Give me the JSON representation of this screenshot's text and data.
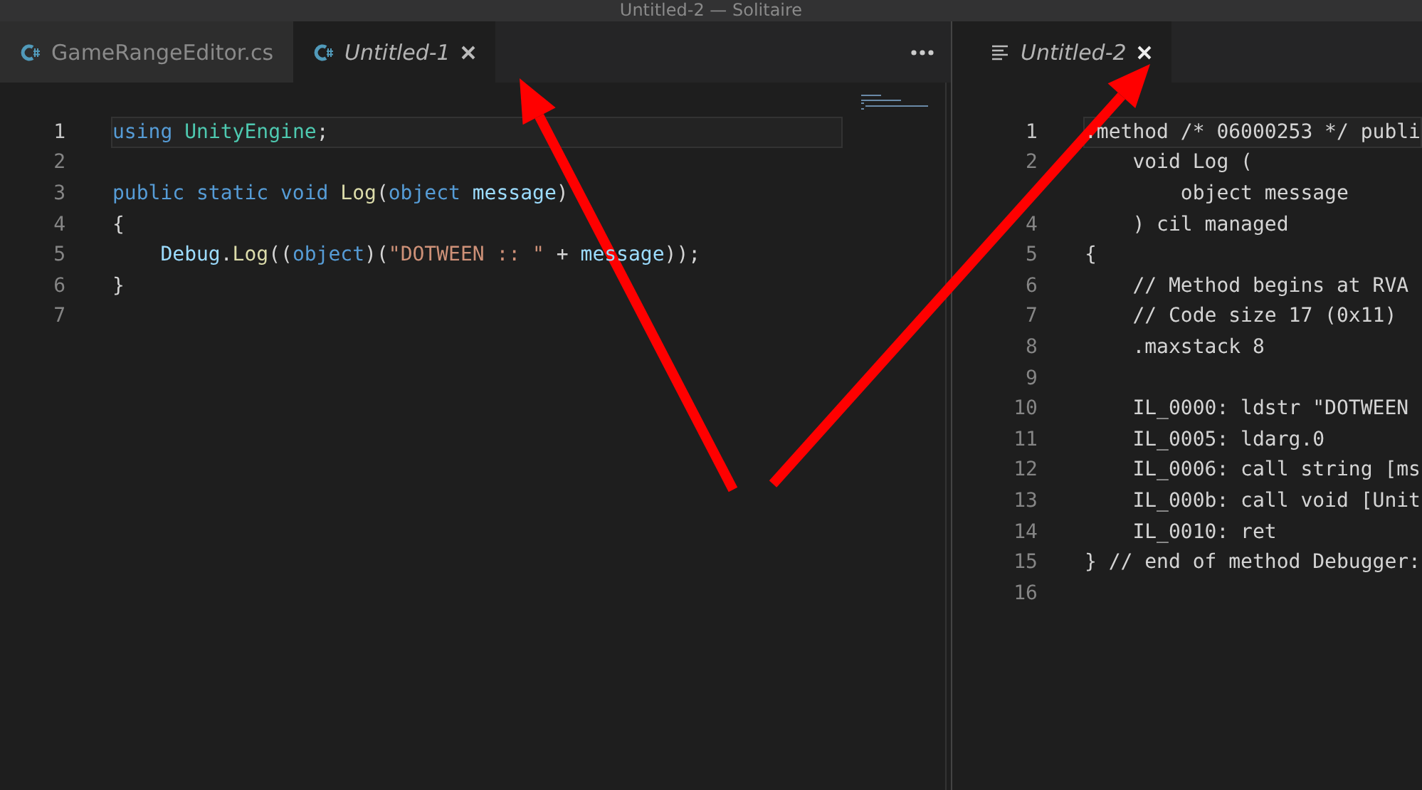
{
  "window": {
    "title": "Untitled-2 — Solitaire"
  },
  "left_group": {
    "tabs": [
      {
        "label": "GameRangeEditor.cs",
        "kind": "csharp",
        "selected": false,
        "preview": false
      },
      {
        "label": "Untitled-1",
        "kind": "csharp",
        "selected": true,
        "preview": true
      }
    ],
    "editor": {
      "lines": [
        {
          "number": "1",
          "current": true,
          "tokens": [
            {
              "kind": "keyword",
              "text": "using"
            },
            {
              "kind": "type",
              "text": " UnityEngine"
            },
            {
              "kind": "plain",
              "text": ";"
            }
          ]
        },
        {
          "number": "2",
          "current": false
        },
        {
          "number": "3",
          "current": false,
          "tokens": [
            {
              "kind": "keyword",
              "text": "public static void"
            },
            {
              "kind": "function",
              "text": " Log"
            },
            {
              "kind": "plain",
              "text": "("
            },
            {
              "kind": "keyword",
              "text": "object"
            },
            {
              "kind": "variable",
              "text": " message"
            },
            {
              "kind": "plain",
              "text": ")"
            }
          ]
        },
        {
          "number": "4",
          "current": false,
          "tokens": [
            {
              "kind": "plain",
              "text": "{"
            }
          ]
        },
        {
          "number": "5",
          "current": false,
          "tokens": [
            {
              "kind": "variable",
              "text": "    Debug"
            },
            {
              "kind": "plain",
              "text": "."
            },
            {
              "kind": "function",
              "text": "Log"
            },
            {
              "kind": "plain",
              "text": "(("
            },
            {
              "kind": "keyword",
              "text": "object"
            },
            {
              "kind": "plain",
              "text": ")("
            },
            {
              "kind": "string",
              "text": "\"DOTWEEN :: \""
            },
            {
              "kind": "plain",
              "text": " + "
            },
            {
              "kind": "variable",
              "text": "message"
            },
            {
              "kind": "plain",
              "text": "));"
            }
          ]
        },
        {
          "number": "6",
          "current": false,
          "tokens": [
            {
              "kind": "plain",
              "text": "}"
            }
          ]
        },
        {
          "number": "7",
          "current": false
        }
      ]
    }
  },
  "right_group": {
    "tabs": [
      {
        "label": "Untitled-2",
        "kind": "text",
        "selected": true,
        "preview": true
      }
    ],
    "editor": {
      "lines": [
        {
          "number": "1",
          "current": true,
          "text": ".method /* 06000253 */ publi"
        },
        {
          "number": "2",
          "current": false,
          "text": "    void Log ("
        },
        {
          "current": false,
          "text": "        object message"
        },
        {
          "number": "4",
          "current": false,
          "text": "    ) cil managed"
        },
        {
          "number": "5",
          "current": false,
          "text": "{"
        },
        {
          "number": "6",
          "current": false,
          "text": "    // Method begins at RVA"
        },
        {
          "number": "7",
          "current": false,
          "text": "    // Code size 17 (0x11)"
        },
        {
          "number": "8",
          "current": false,
          "text": "    .maxstack 8"
        },
        {
          "number": "9",
          "current": false
        },
        {
          "number": "10",
          "current": false,
          "text": "    IL_0000: ldstr \"DOTWEEN"
        },
        {
          "number": "11",
          "current": false,
          "text": "    IL_0005: ldarg.0"
        },
        {
          "number": "12",
          "current": false,
          "text": "    IL_0006: call string [ms"
        },
        {
          "number": "13",
          "current": false,
          "text": "    IL_000b: call void [Unit"
        },
        {
          "number": "14",
          "current": false,
          "text": "    IL_0010: ret"
        },
        {
          "number": "15",
          "current": false,
          "text": "} // end of method Debugger:"
        },
        {
          "number": "16",
          "current": false
        }
      ]
    }
  }
}
